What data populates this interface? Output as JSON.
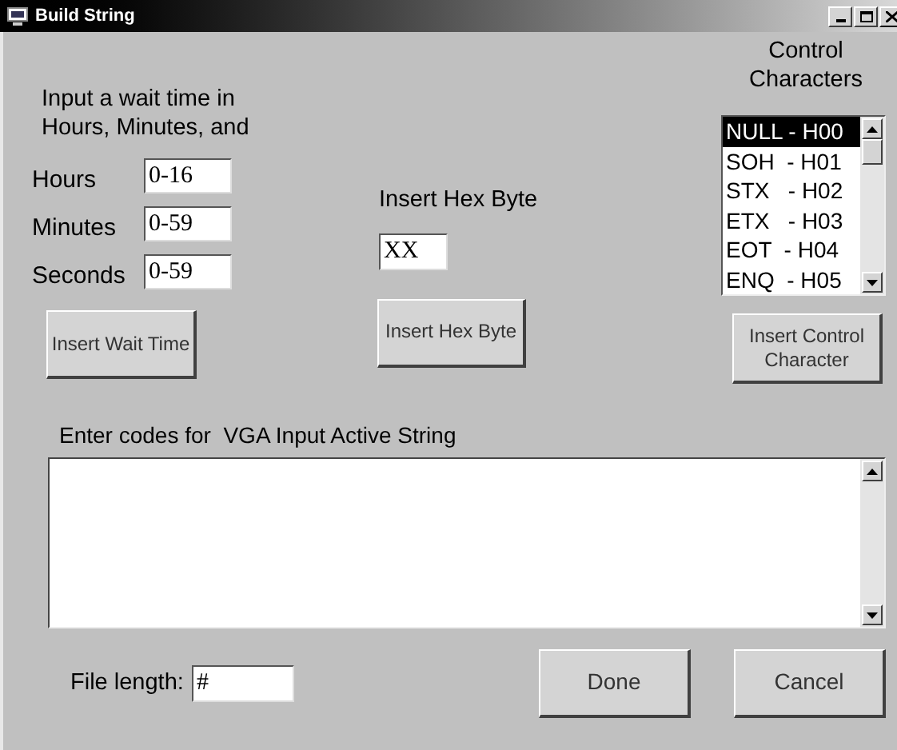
{
  "window": {
    "title": "Build String"
  },
  "wait_time": {
    "prompt": "Input a wait time in Hours, Minutes, and",
    "fields": [
      {
        "label": "Hours",
        "value": "0-16"
      },
      {
        "label": "Minutes",
        "value": "0-59"
      },
      {
        "label": "Seconds",
        "value": "0-59"
      }
    ],
    "button": "Insert Wait Time"
  },
  "hex_byte": {
    "label": "Insert Hex Byte",
    "value": "XX",
    "button": "Insert Hex Byte"
  },
  "control_characters": {
    "title": "Control Characters",
    "items": [
      {
        "label": "NULL - H00",
        "selected": true
      },
      {
        "label": "SOH  - H01",
        "selected": false
      },
      {
        "label": "STX   - H02",
        "selected": false
      },
      {
        "label": "ETX   - H03",
        "selected": false
      },
      {
        "label": "EOT  - H04",
        "selected": false
      },
      {
        "label": "ENQ  - H05",
        "selected": false
      }
    ],
    "button": "Insert Control Character"
  },
  "codes": {
    "label": "Enter codes for  VGA Input Active String"
  },
  "file_length": {
    "label": "File length:",
    "value": "#"
  },
  "buttons": [
    "Done",
    "Cancel"
  ]
}
